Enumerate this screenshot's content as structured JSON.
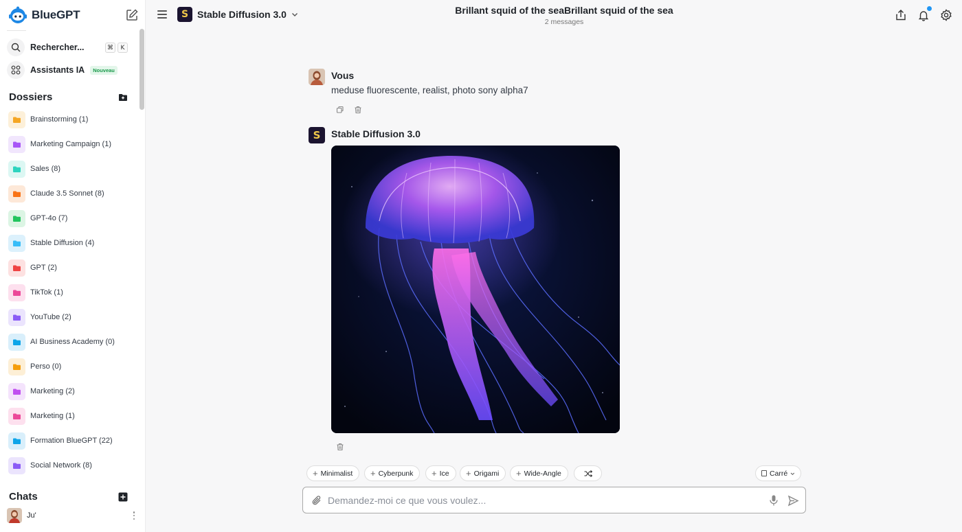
{
  "app": {
    "name": "BlueGPT"
  },
  "sidebar": {
    "search_label": "Rechercher...",
    "search_shortcut": [
      "⌘",
      "K"
    ],
    "assistants_label": "Assistants IA",
    "assistants_badge": "Nouveau",
    "folders_title": "Dossiers",
    "folders": [
      {
        "label": "Brainstorming (1)",
        "color": "#f5a623",
        "bg": "#fdf0d9"
      },
      {
        "label": "Marketing Campaign (1)",
        "color": "#a855f7",
        "bg": "#f1e6fd"
      },
      {
        "label": "Sales (8)",
        "color": "#2dd4bf",
        "bg": "#dcf7f3"
      },
      {
        "label": "Claude 3.5 Sonnet (8)",
        "color": "#f97316",
        "bg": "#fde8d8"
      },
      {
        "label": "GPT-4o (7)",
        "color": "#22c55e",
        "bg": "#dcf5e4"
      },
      {
        "label": "Stable Diffusion (4)",
        "color": "#38bdf8",
        "bg": "#dcf1fc"
      },
      {
        "label": "GPT (2)",
        "color": "#ef4444",
        "bg": "#fde1e1"
      },
      {
        "label": "TikTok (1)",
        "color": "#ec4899",
        "bg": "#fde0ee"
      },
      {
        "label": "YouTube (2)",
        "color": "#8b5cf6",
        "bg": "#ebe4fd"
      },
      {
        "label": "AI Business Academy (0)",
        "color": "#0ea5e9",
        "bg": "#d9effb"
      },
      {
        "label": "Perso (0)",
        "color": "#f59e0b",
        "bg": "#fdefd6"
      },
      {
        "label": "Marketing (2)",
        "color": "#c050f0",
        "bg": "#f4e3fc"
      },
      {
        "label": "Marketing (1)",
        "color": "#ec4899",
        "bg": "#fde0ee"
      },
      {
        "label": "Formation BlueGPT (22)",
        "color": "#0ea5e9",
        "bg": "#d9effb"
      },
      {
        "label": "Social Network (8)",
        "color": "#8b5cf6",
        "bg": "#ebe4fd"
      }
    ],
    "chats_title": "Chats",
    "user": {
      "name": "Ju'"
    }
  },
  "topbar": {
    "model_name": "Stable Diffusion 3.0",
    "model_logo_letter": "S",
    "conversation_title": "Brillant squid of the seaBrillant squid of the sea",
    "conversation_meta": "2 messages"
  },
  "messages": [
    {
      "author": "Vous",
      "text": "meduse fluorescente, realist, photo sony alpha7"
    },
    {
      "author": "Stable Diffusion 3.0"
    }
  ],
  "style_chips": [
    "Minimalist",
    "Cyberpunk",
    "Ice",
    "Origami",
    "Wide-Angle"
  ],
  "aspect_ratio": "Carré",
  "composer": {
    "placeholder": "Demandez-moi ce que vous voulez..."
  },
  "colors": {
    "brand": "#1e88e5",
    "notification": "#2196f3",
    "model_logo_bg": "#1b1430"
  }
}
